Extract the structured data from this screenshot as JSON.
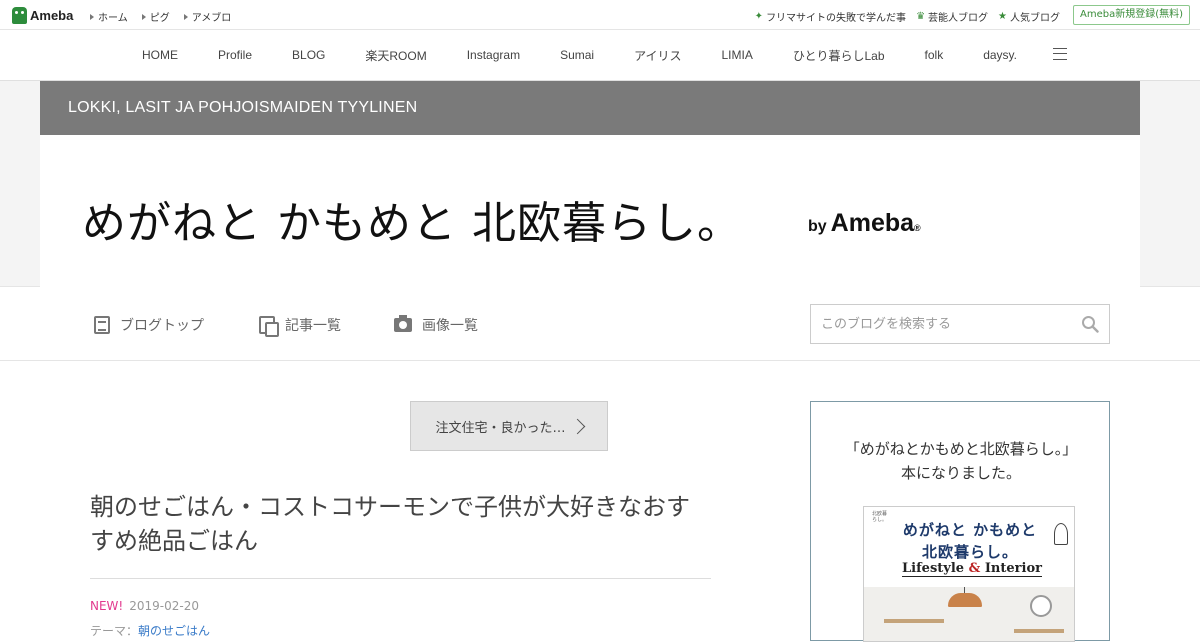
{
  "ameba_bar": {
    "logo_text": "Ameba",
    "links": [
      "ホーム",
      "ピグ",
      "アメブロ"
    ],
    "right_links": [
      {
        "icon": "sparkle-icon",
        "label": "フリマサイトの失敗で学んだ事"
      },
      {
        "icon": "crown-icon",
        "label": "芸能人ブログ"
      },
      {
        "icon": "star-icon",
        "label": "人気ブログ"
      }
    ],
    "register_label": "Ameba新規登録(無料)"
  },
  "main_nav": {
    "items": [
      "HOME",
      "Profile",
      "BLOG",
      "楽天ROOM",
      "Instagram",
      "Sumai",
      "アイリス",
      "LIMIA",
      "ひとり暮らしLab",
      "folk",
      "daysy."
    ]
  },
  "header": {
    "subtitle": "LOKKI, LASIT JA POHJOISMAIDEN TYYLINEN",
    "title": "めがねと かもめと 北欧暮らし。",
    "by_label": "by",
    "brand": "Ameba",
    "brand_mark": "®"
  },
  "blog_nav": {
    "top": "ブログトップ",
    "list": "記事一覧",
    "images": "画像一覧",
    "search_placeholder": "このブログを検索する"
  },
  "article": {
    "prev_label": "注文住宅・良かった…",
    "title": "朝のせごはん・コストコサーモンで子供が大好きなおすすめ絶品ごはん",
    "new_badge": "NEW!",
    "date": "2019-02-20",
    "theme_prefix": "テーマ：",
    "theme": "朝のせごはん"
  },
  "sidebar": {
    "caption_line1": "「めがねとかもめと北欧暮らし。」",
    "caption_line2": "本になりました。",
    "book": {
      "small_text": "北欧暮\nらし。",
      "line1": "めがねと かもめと",
      "line2": "北欧暮らし。",
      "line3_a": "Lifestyle",
      "line3_amp": "&",
      "line3_b": "Interior"
    }
  },
  "colors": {
    "header_band": "#7a7a7a",
    "new_badge": "#e23a8f",
    "link": "#3a7bc8",
    "brand_green": "#2d8c3c"
  }
}
